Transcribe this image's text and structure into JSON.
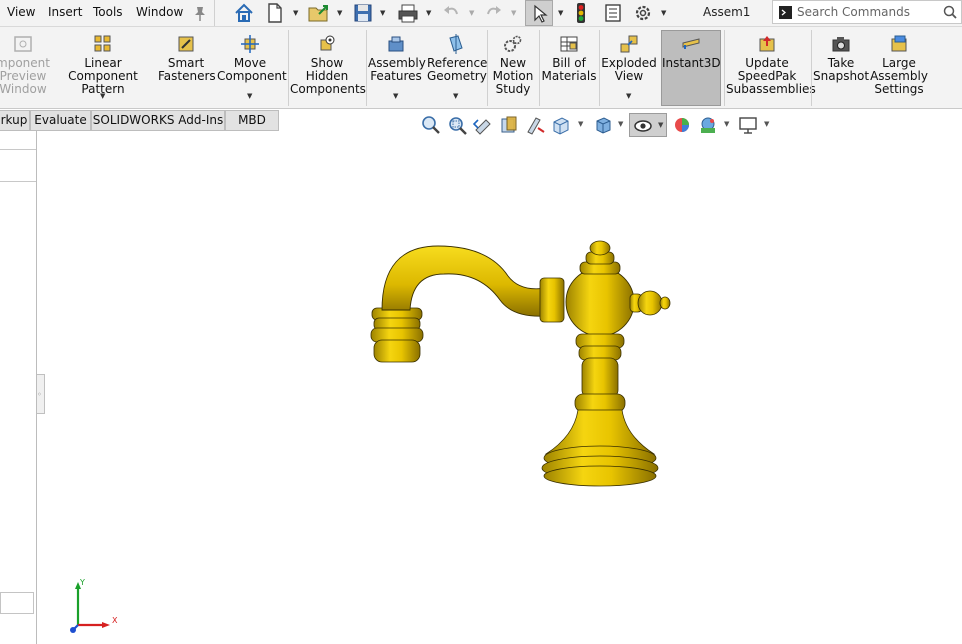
{
  "menu": {
    "items": [
      "View",
      "Insert",
      "Tools",
      "Window"
    ],
    "doc_title": "Assem1",
    "search_placeholder": "Search Commands"
  },
  "ribbon": {
    "buttons": [
      {
        "id": "preview",
        "label": "mponent\nPreview\nWindow",
        "disabled": true,
        "icon": "preview-window-icon"
      },
      {
        "id": "linear",
        "label": "Linear Component\nPattern",
        "icon": "linear-pattern-icon"
      },
      {
        "id": "smart",
        "label": "Smart\nFasteners",
        "icon": "smart-fasteners-icon"
      },
      {
        "id": "move",
        "label": "Move\nComponent",
        "icon": "move-component-icon"
      },
      {
        "id": "show",
        "label": "Show\nHidden\nComponents",
        "icon": "show-hidden-icon"
      },
      {
        "id": "assembly",
        "label": "Assembly\nFeatures",
        "icon": "assembly-features-icon"
      },
      {
        "id": "refgeom",
        "label": "Reference\nGeometry",
        "icon": "reference-geometry-icon"
      },
      {
        "id": "motion",
        "label": "New\nMotion\nStudy",
        "icon": "motion-study-icon"
      },
      {
        "id": "bom",
        "label": "Bill of\nMaterials",
        "icon": "bill-of-materials-icon"
      },
      {
        "id": "exploded",
        "label": "Exploded\nView",
        "icon": "exploded-view-icon"
      },
      {
        "id": "instant3d",
        "label": "Instant3D",
        "icon": "instant3d-icon"
      },
      {
        "id": "speedpak",
        "label": "Update\nSpeedPak\nSubassemblies",
        "icon": "speedpak-icon"
      },
      {
        "id": "snapshot",
        "label": "Take\nSnapshot",
        "icon": "camera-icon"
      },
      {
        "id": "large",
        "label": "Large\nAssembly\nSettings",
        "icon": "large-assembly-icon"
      }
    ]
  },
  "tabs": [
    "rkup",
    "Evaluate",
    "SOLIDWORKS Add-Ins",
    "MBD"
  ],
  "triad": {
    "y_label": "Y",
    "x_label": "X"
  },
  "colors": {
    "model_gold": "#e8c400",
    "model_dark": "#7a6000",
    "accent_blue": "#1a5fb4"
  }
}
